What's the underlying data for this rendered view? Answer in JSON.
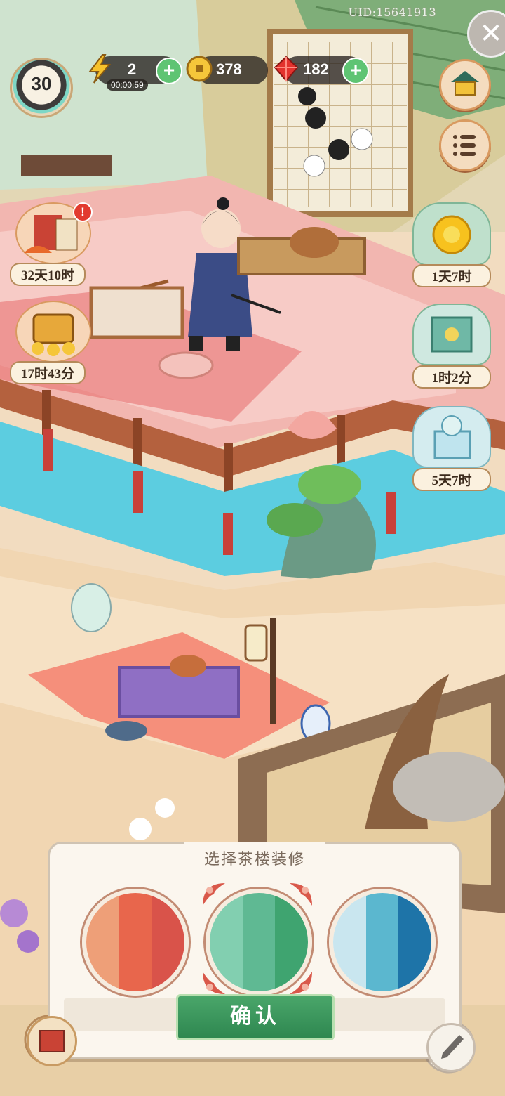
{
  "header": {
    "uid": "UID:15641913",
    "level": "30",
    "energy": {
      "value": "2",
      "timer": "00:00:59"
    },
    "coins": {
      "value": "378"
    },
    "gems": {
      "value": "182"
    }
  },
  "side_timers": {
    "left": [
      {
        "label": "32天10时",
        "icon": "scroll-book-icon",
        "alert": "!"
      },
      {
        "label": "17时43分",
        "icon": "treasure-chest-icon"
      }
    ],
    "right": [
      {
        "label": "1天7时",
        "icon": "chrysanthemum-icon"
      },
      {
        "label": "1时2分",
        "icon": "jade-box-icon"
      },
      {
        "label": "5天7时",
        "icon": "gift-cat-icon"
      }
    ]
  },
  "panel": {
    "title": "选择茶楼装修",
    "options": [
      {
        "name": "red-theme",
        "colors": [
          "#ee9f78",
          "#e8664c",
          "#d9534a"
        ]
      },
      {
        "name": "green-theme",
        "colors": [
          "#82cfb0",
          "#5fb993",
          "#3fa470"
        ]
      },
      {
        "name": "blue-theme",
        "colors": [
          "#c9e6ef",
          "#5bb7cf",
          "#1e74a8"
        ]
      }
    ],
    "selected_index": 1,
    "confirm_label": "确认"
  }
}
